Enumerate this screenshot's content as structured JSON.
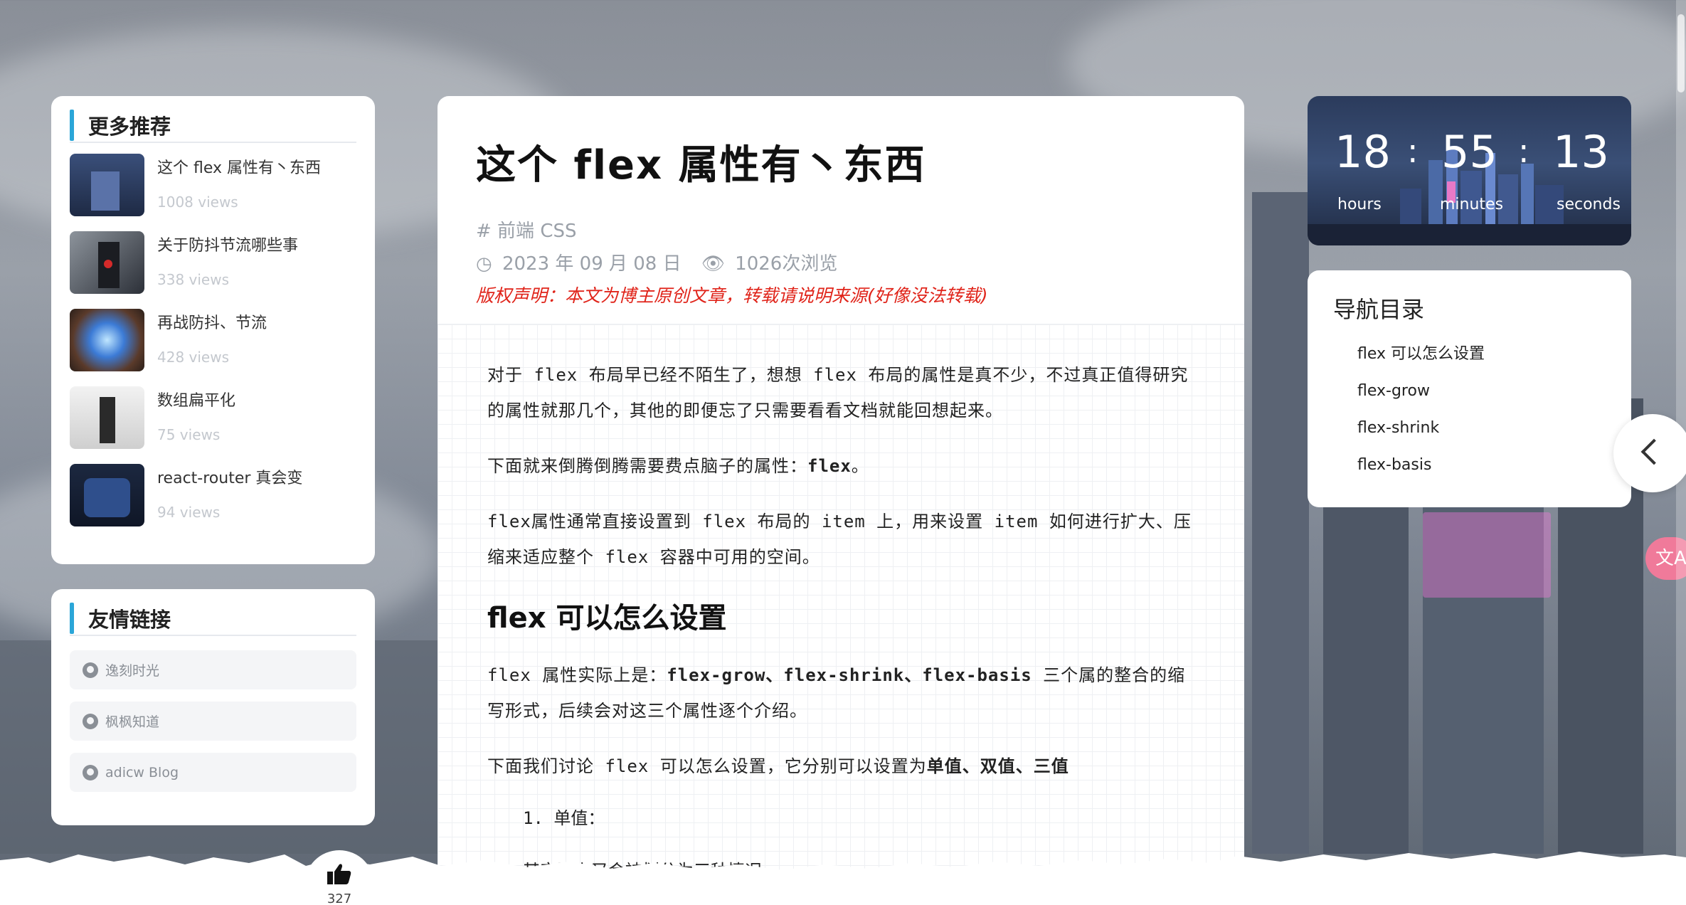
{
  "recommend": {
    "title": "更多推荐",
    "items": [
      {
        "title": "这个 flex 属性有丶东西",
        "views": "1008 views"
      },
      {
        "title": "关于防抖节流哪些事",
        "views": "338 views"
      },
      {
        "title": "再战防抖、节流",
        "views": "428 views"
      },
      {
        "title": "数组扁平化",
        "views": "75 views"
      },
      {
        "title": "react-router 真会变",
        "views": "94 views"
      }
    ]
  },
  "friends": {
    "title": "友情链接",
    "links": [
      "逸刻时光",
      "枫枫知道",
      "adicw Blog"
    ]
  },
  "article": {
    "title": "这个 flex 属性有丶东西",
    "tags": "# 前端 CSS",
    "date": "2023 年 09 月 08 日",
    "views": "1026次浏览",
    "copyright": "版权声明：本文为博主原创文章，转载请说明来源(好像没法转载)",
    "p1": "对于 flex 布局早已经不陌生了，想想 flex 布局的属性是真不少，不过真正值得研究的属性就那几个，其他的即便忘了只需要看看文档就能回想起来。",
    "p2_prefix": "下面就来倒腾倒腾需要费点脑子的属性：",
    "p2_bold": "flex",
    "p2_suffix": "。",
    "p3": "flex属性通常直接设置到 flex 布局的 item 上，用来设置 item 如何进行扩大、压缩来适应整个 flex 容器中可用的空间。",
    "h2": "flex 可以怎么设置",
    "p4_prefix": "flex 属性实际上是：",
    "p4_bold": "flex-grow、flex-shrink、flex-basis",
    "p4_suffix": " 三个属的整合的缩写形式，后续会对这三个属性逐个介绍。",
    "p5_prefix": "下面我们讨论 flex 可以怎么设置，它分别可以设置为",
    "p5_bold": "单值、双值、三值",
    "li1": "1. 单值：",
    "li2": "其实际上又会被划分为三种情况"
  },
  "clock": {
    "hours": "18",
    "minutes": "55",
    "seconds": "13",
    "colon": ":",
    "hours_label": "hours",
    "minutes_label": "minutes",
    "seconds_label": "seconds"
  },
  "toc": {
    "title": "导航目录",
    "items": [
      "flex 可以怎么设置",
      "flex-grow",
      "flex-shrink",
      "flex-basis"
    ]
  },
  "side": {
    "translate_label": "文A"
  },
  "like": {
    "count": "327"
  },
  "colors": {
    "accent": "#2ba6d8",
    "copyright": "#e0241a",
    "translate": "#f07a9a"
  }
}
